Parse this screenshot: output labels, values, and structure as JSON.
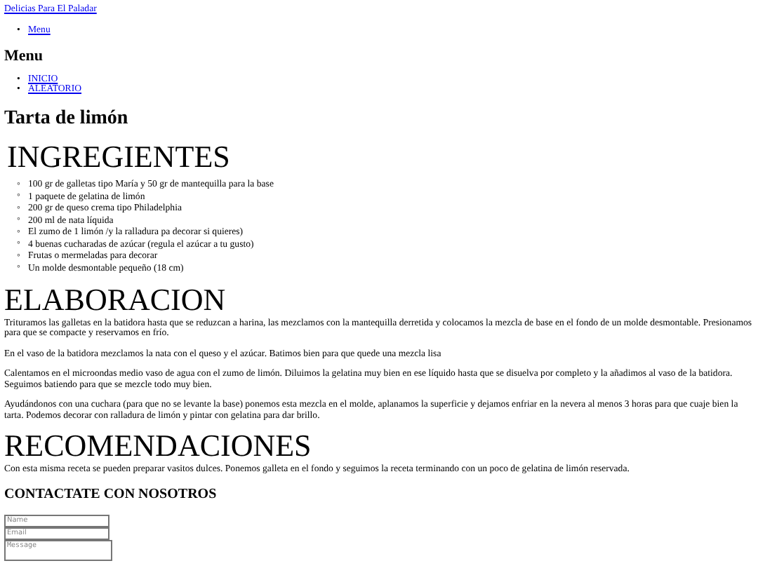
{
  "site_link": "Delicias Para El Paladar",
  "nav": {
    "marker": "•",
    "items": [
      "Menu"
    ]
  },
  "menu": {
    "title": "Menu",
    "marker": "•",
    "items": [
      "INICIO",
      "ALEATORIO"
    ]
  },
  "title": "Tarta de limón",
  "sections": [
    {
      "heading": "INGREGIENTES",
      "kind": "list",
      "marker": "◦",
      "items": [
        "100 gr de galletas tipo María y 50 gr de mantequilla para la base",
        "1 paquete de gelatina de limón",
        "200 gr de queso crema tipo Philadelphia",
        "200 ml de nata líquida",
        "El zumo de 1 limón /y la ralladura pa decorar si quieres)",
        "4 buenas cucharadas de azúcar (regula el azúcar a tu gusto)",
        "Frutas o mermeladas para decorar",
        "Un molde desmontable pequeño (18 cm)"
      ]
    },
    {
      "heading": "ELABORACION",
      "kind": "paragraphs",
      "items": [
        "Trituramos las galletas en la batidora hasta que se reduzcan a harina, las mezclamos con la mantequilla derretida y colocamos la mezcla de base en el fondo de un molde desmontable. Presionamos para que se compacte y reservamos en frío.",
        "En el vaso de la batidora mezclamos la nata con el queso y el azúcar. Batimos bien para que quede una mezcla lisa",
        "Calentamos en el microondas medio vaso de agua con el zumo de limón. Diluimos la gelatina muy bien en ese líquido hasta que se disuelva por completo y la añadimos al vaso de la batidora. Seguimos batiendo para que se mezcle todo muy bien.",
        "Ayudándonos con una cuchara (para que no se levante la base) ponemos esta mezcla en el molde, aplanamos la superficie y dejamos enfriar en la nevera al menos 3 horas para que cuaje bien la tarta. Podemos decorar con ralladura de limón y pintar con gelatina para dar brillo."
      ]
    },
    {
      "heading": "RECOMENDACIONES",
      "kind": "paragraphs",
      "items": [
        "Con esta misma receta se pueden preparar vasitos dulces. Ponemos galleta en el fondo y seguimos la receta terminando con un poco de gelatina de limón reservada."
      ]
    }
  ],
  "contact": {
    "title": "CONTACTATE CON NOSOTROS",
    "fields": [
      {
        "kind": "input",
        "placeholder": "Name"
      },
      {
        "kind": "input",
        "placeholder": "Email"
      },
      {
        "kind": "textarea",
        "placeholder": "Message"
      }
    ]
  }
}
